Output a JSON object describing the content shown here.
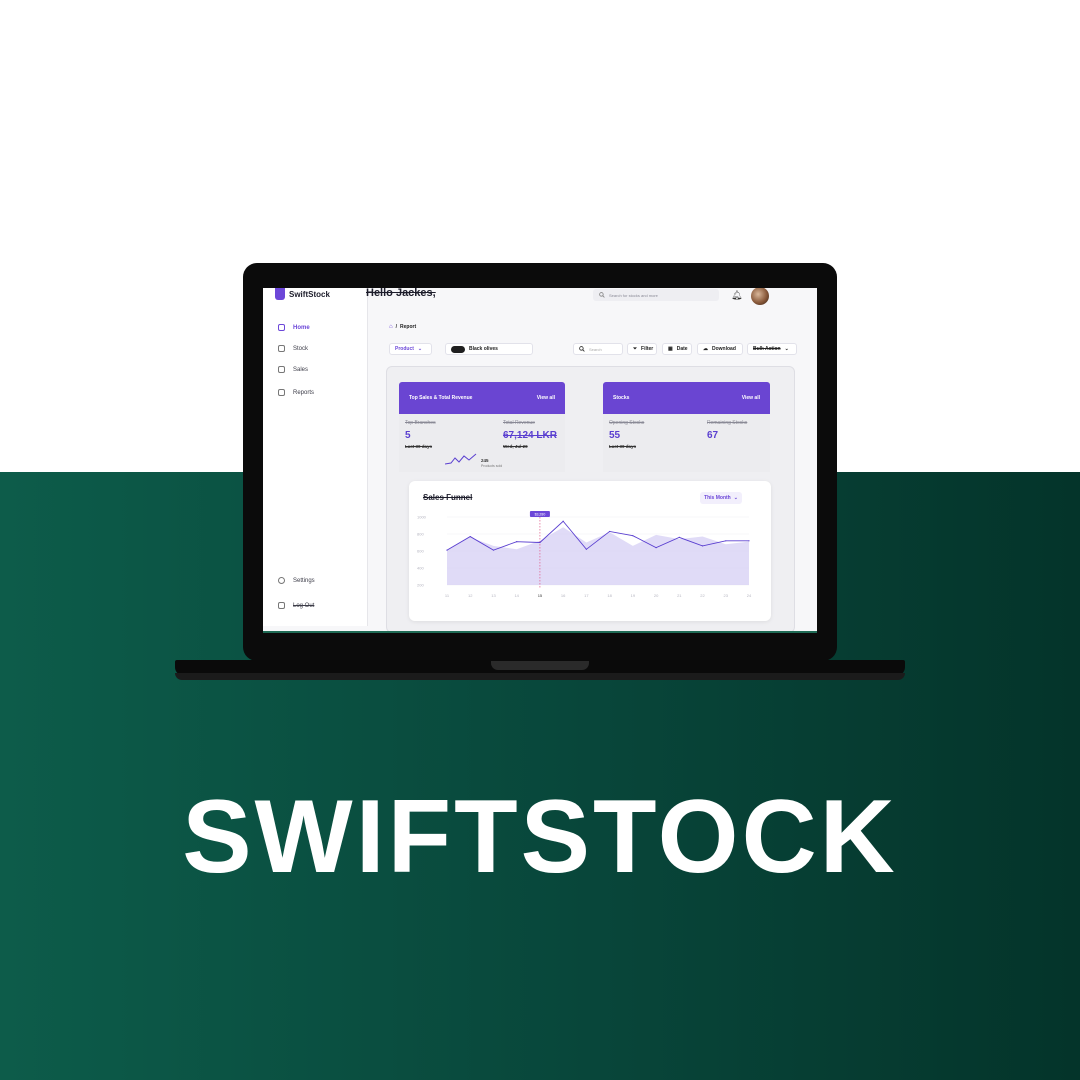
{
  "brand": {
    "title": "SWIFTSTOCK"
  },
  "app": {
    "logo_text": "SwiftStock",
    "greeting": "Hello Jackes,",
    "search_placeholder": "Search for stocks and more",
    "sidebar": {
      "items": [
        {
          "label": "Home",
          "icon": "home-icon",
          "active": true
        },
        {
          "label": "Stock",
          "icon": "stock-icon"
        },
        {
          "label": "Sales",
          "icon": "sales-icon"
        },
        {
          "label": "Reports",
          "icon": "reports-icon"
        }
      ],
      "settings": "Settings",
      "logout": "Log Out"
    },
    "breadcrumb": {
      "separator": "/",
      "page": "Report"
    },
    "filters": {
      "product": "Product",
      "product_name": "Black olives",
      "search_placeholder": "Search",
      "filter": "Filter",
      "date": "Date",
      "download": "Download",
      "bulk_action": "Bulk Action"
    },
    "cards": {
      "sales": {
        "title": "Top Sales & Total Revenue",
        "view_all": "View all",
        "branches_label": "Top Branches",
        "branches_value": "5",
        "branches_period": "Last 30 days",
        "revenue_label": "Total Revenue",
        "revenue_value": "67,124 LKR",
        "revenue_date": "Wed, Jul 20",
        "products_sold_value": "245",
        "products_sold_label": "Products sold"
      },
      "stocks": {
        "title": "Stocks",
        "view_all": "View all",
        "opening_label": "Opening Stocks",
        "opening_value": "55",
        "opening_period": "Last 30 days",
        "remaining_label": "Remaining Stocks",
        "remaining_value": "67"
      }
    },
    "funnel": {
      "title": "Sales Funnel",
      "period": "This Month"
    }
  },
  "chart_data": {
    "type": "line",
    "title": "Sales Funnel",
    "categories": [
      "11",
      "12",
      "13",
      "14",
      "15",
      "16",
      "17",
      "18",
      "19",
      "20",
      "21",
      "22",
      "23",
      "24"
    ],
    "ylim": [
      200,
      1000
    ],
    "series": [
      {
        "values": [
          610,
          770,
          610,
          710,
          700,
          950,
          620,
          830,
          780,
          640,
          760,
          660,
          720,
          720
        ]
      }
    ],
    "area_values": [
      610,
      760,
      660,
      620,
      720,
      880,
      700,
      820,
      660,
      790,
      740,
      770,
      680,
      710
    ],
    "highlight": {
      "category": "15",
      "label": "$3,280"
    },
    "colors": {
      "line": "#5a3fd0",
      "area": "#d6cff4"
    }
  }
}
